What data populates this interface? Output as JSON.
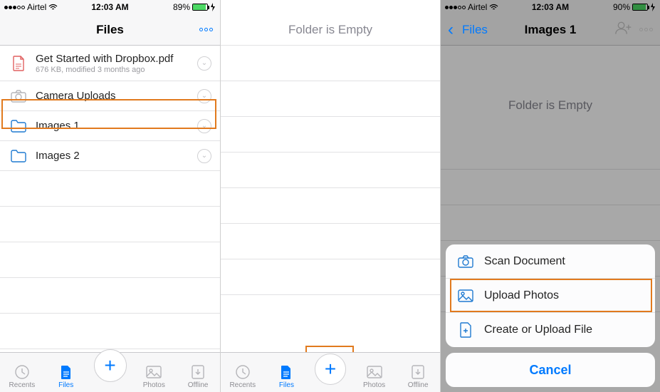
{
  "colors": {
    "accent": "#007aff",
    "highlight": "#e17a1e",
    "battery": "#4cd964"
  },
  "screen1": {
    "status": {
      "carrier": "Airtel",
      "time": "12:03 AM",
      "battery_pct": "89%",
      "battery_level": 89
    },
    "nav_title": "Files",
    "file": {
      "name": "Get Started with Dropbox.pdf",
      "meta": "676 KB, modified 3 months ago"
    },
    "rows": [
      {
        "label": "Camera Uploads"
      },
      {
        "label": "Images 1"
      },
      {
        "label": "Images 2"
      }
    ],
    "tabs": {
      "recents": "Recents",
      "files": "Files",
      "photos": "Photos",
      "offline": "Offline"
    }
  },
  "screen2": {
    "empty_text": "Folder is Empty",
    "tabs": {
      "recents": "Recents",
      "files": "Files",
      "photos": "Photos",
      "offline": "Offline"
    }
  },
  "screen3": {
    "status": {
      "carrier": "Airtel",
      "time": "12:03 AM",
      "battery_pct": "90%",
      "battery_level": 90
    },
    "nav": {
      "back_label": "Files",
      "title": "Images 1"
    },
    "empty_text": "Folder is Empty",
    "sheet": {
      "scan": "Scan Document",
      "upload_photos": "Upload Photos",
      "create_file": "Create or Upload File",
      "cancel": "Cancel"
    }
  }
}
